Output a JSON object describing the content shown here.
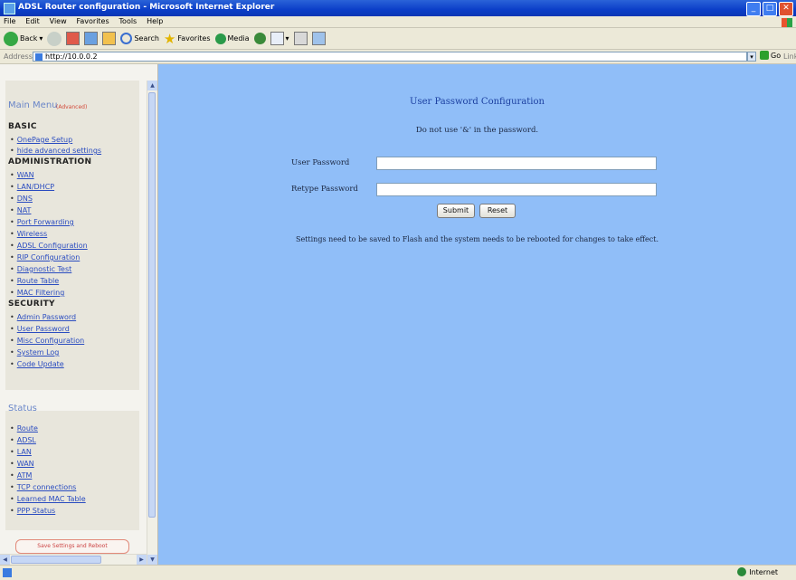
{
  "window": {
    "title": "ADSL Router configuration - Microsoft Internet Explorer"
  },
  "menubar": [
    "File",
    "Edit",
    "View",
    "Favorites",
    "Tools",
    "Help"
  ],
  "toolbar": {
    "back": "Back",
    "search": "Search",
    "favorites": "Favorites",
    "media": "Media"
  },
  "address": {
    "label": "Address",
    "url": "http://10.0.0.2",
    "go": "Go",
    "links": "Links"
  },
  "sidebar": {
    "main_menu": "Main Menu",
    "advanced": "(Advanced)",
    "basic": "BASIC",
    "basic_items": [
      "OnePage Setup",
      "hide advanced settings"
    ],
    "administration": "ADMINISTRATION",
    "admin_items": [
      "WAN",
      "LAN/DHCP",
      "DNS",
      "NAT",
      "Port Forwarding",
      "Wireless",
      "ADSL Configuration",
      "RIP Configuration",
      "Diagnostic Test",
      "Route Table",
      "MAC Filtering"
    ],
    "security": "SECURITY",
    "security_items": [
      "Admin Password",
      "User Password",
      "Misc Configuration",
      "System Log",
      "Code Update"
    ],
    "status": "Status",
    "status_items": [
      "Route",
      "ADSL",
      "LAN",
      "WAN",
      "ATM",
      "TCP connections",
      "Learned MAC Table",
      "PPP Status"
    ],
    "bottom_button": "Save Settings and Reboot"
  },
  "main": {
    "title": "User Password Configuration",
    "notice": "Do not use '&' in the password.",
    "user_password_label": "User Password",
    "user_password_value": "",
    "retype_password_label": "Retype Password",
    "retype_password_value": "",
    "submit": "Submit",
    "reset": "Reset",
    "info": "Settings need to be saved to Flash and the system needs to be rebooted for changes to take effect."
  },
  "statusbar": {
    "zone": "Internet"
  },
  "colors": {
    "content_bg": "#90bef8",
    "title_bar": "#0b3ec8",
    "link": "#2a4cc0"
  }
}
